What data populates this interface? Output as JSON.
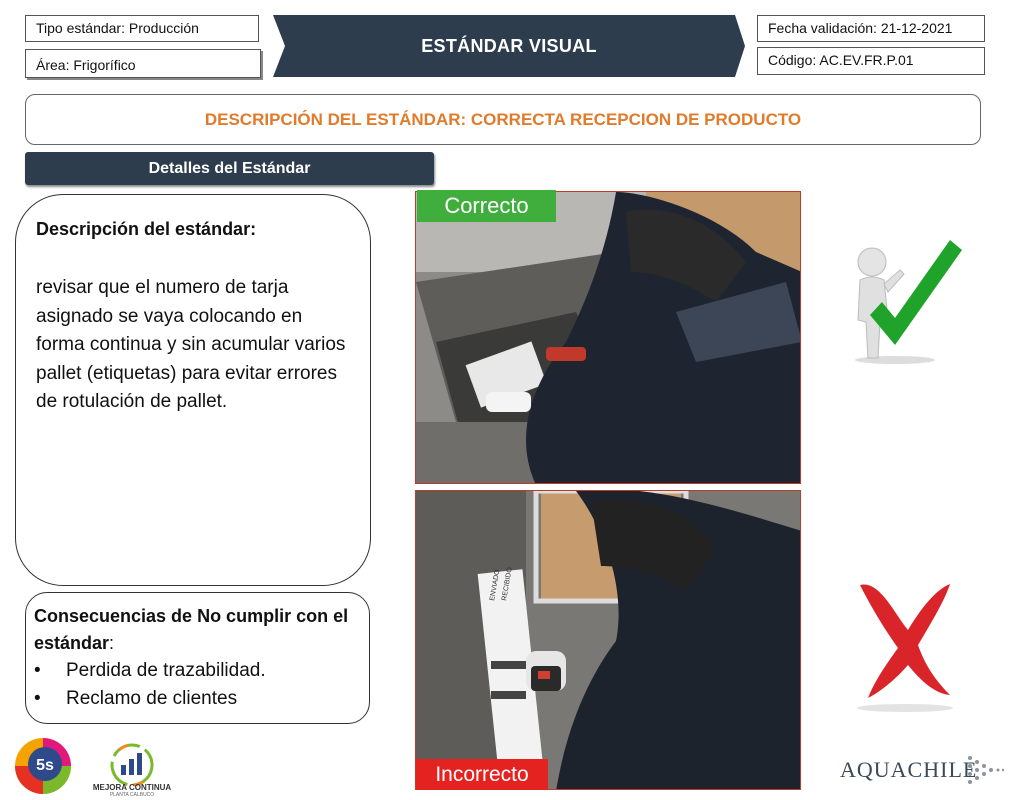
{
  "header": {
    "tipo": "Tipo estándar: Producción",
    "area": "Área: Frigorífico",
    "banner_title": "ESTÁNDAR VISUAL",
    "fecha": "Fecha validación: 21-12-2021",
    "codigo": "Código: AC.EV.FR.P.01"
  },
  "description_title": "DESCRIPCIÓN DEL ESTÁNDAR: CORRECTA RECEPCION DE PRODUCTO",
  "details_header": "Detalles del Estándar",
  "standard": {
    "title": "Descripción  del estándar:",
    "body": "revisar que el numero de tarja asignado se vaya colocando en forma continua y sin acumular varios pallet (etiquetas) para evitar errores de rotulación de pallet."
  },
  "consequences": {
    "title": "Consecuencias de No cumplir con el estándar",
    "title_suffix": ":",
    "items": [
      "Perdida de trazabilidad.",
      "Reclamo de clientes"
    ]
  },
  "photos": {
    "correct_label": "Correcto",
    "incorrect_label": "Incorrecto",
    "label_text_1": "ENVIADO",
    "label_text_2": "RECIBIDO"
  },
  "icons": {
    "check": "check-figure-icon",
    "cross": "red-x-icon"
  },
  "logos": {
    "five_s": "5s",
    "mejora": "MEJORA CONTINUA",
    "mejora_sub": "PLANTA CALBUCO",
    "brand": "AQUACHILE"
  },
  "colors": {
    "banner": "#2e3d4d",
    "orange_title": "#e07b2c",
    "correct_green": "#3fae3c",
    "incorrect_red": "#e42320",
    "check_green": "#1fa32a",
    "x_red": "#d9252a"
  }
}
